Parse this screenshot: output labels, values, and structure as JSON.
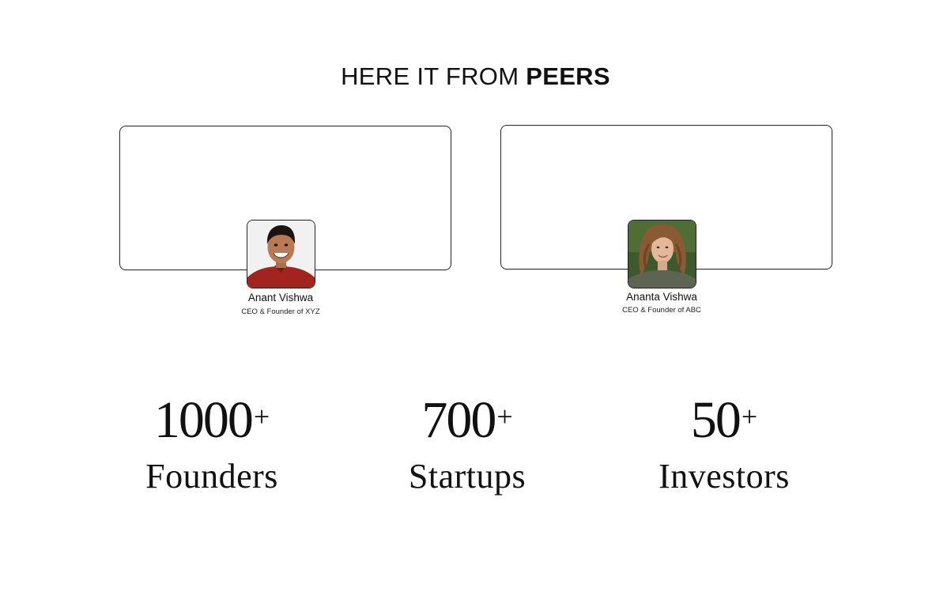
{
  "heading": {
    "light": "HERE IT FROM ",
    "bold": "PEERS"
  },
  "testimonials": [
    {
      "name": "Anant Vishwa",
      "role": "CEO & Founder of XYZ",
      "avatar_icon": "man-portrait"
    },
    {
      "name": "Ananta Vishwa",
      "role": "CEO & Founder of ABC",
      "avatar_icon": "woman-portrait"
    }
  ],
  "stats": [
    {
      "value": "1000",
      "suffix": "+",
      "label": "Founders"
    },
    {
      "value": "700",
      "suffix": "+",
      "label": "Startups"
    },
    {
      "value": "50",
      "suffix": "+",
      "label": "Investors"
    }
  ],
  "colors": {
    "background": "#ffffff",
    "text": "#111111",
    "border": "#222222"
  }
}
